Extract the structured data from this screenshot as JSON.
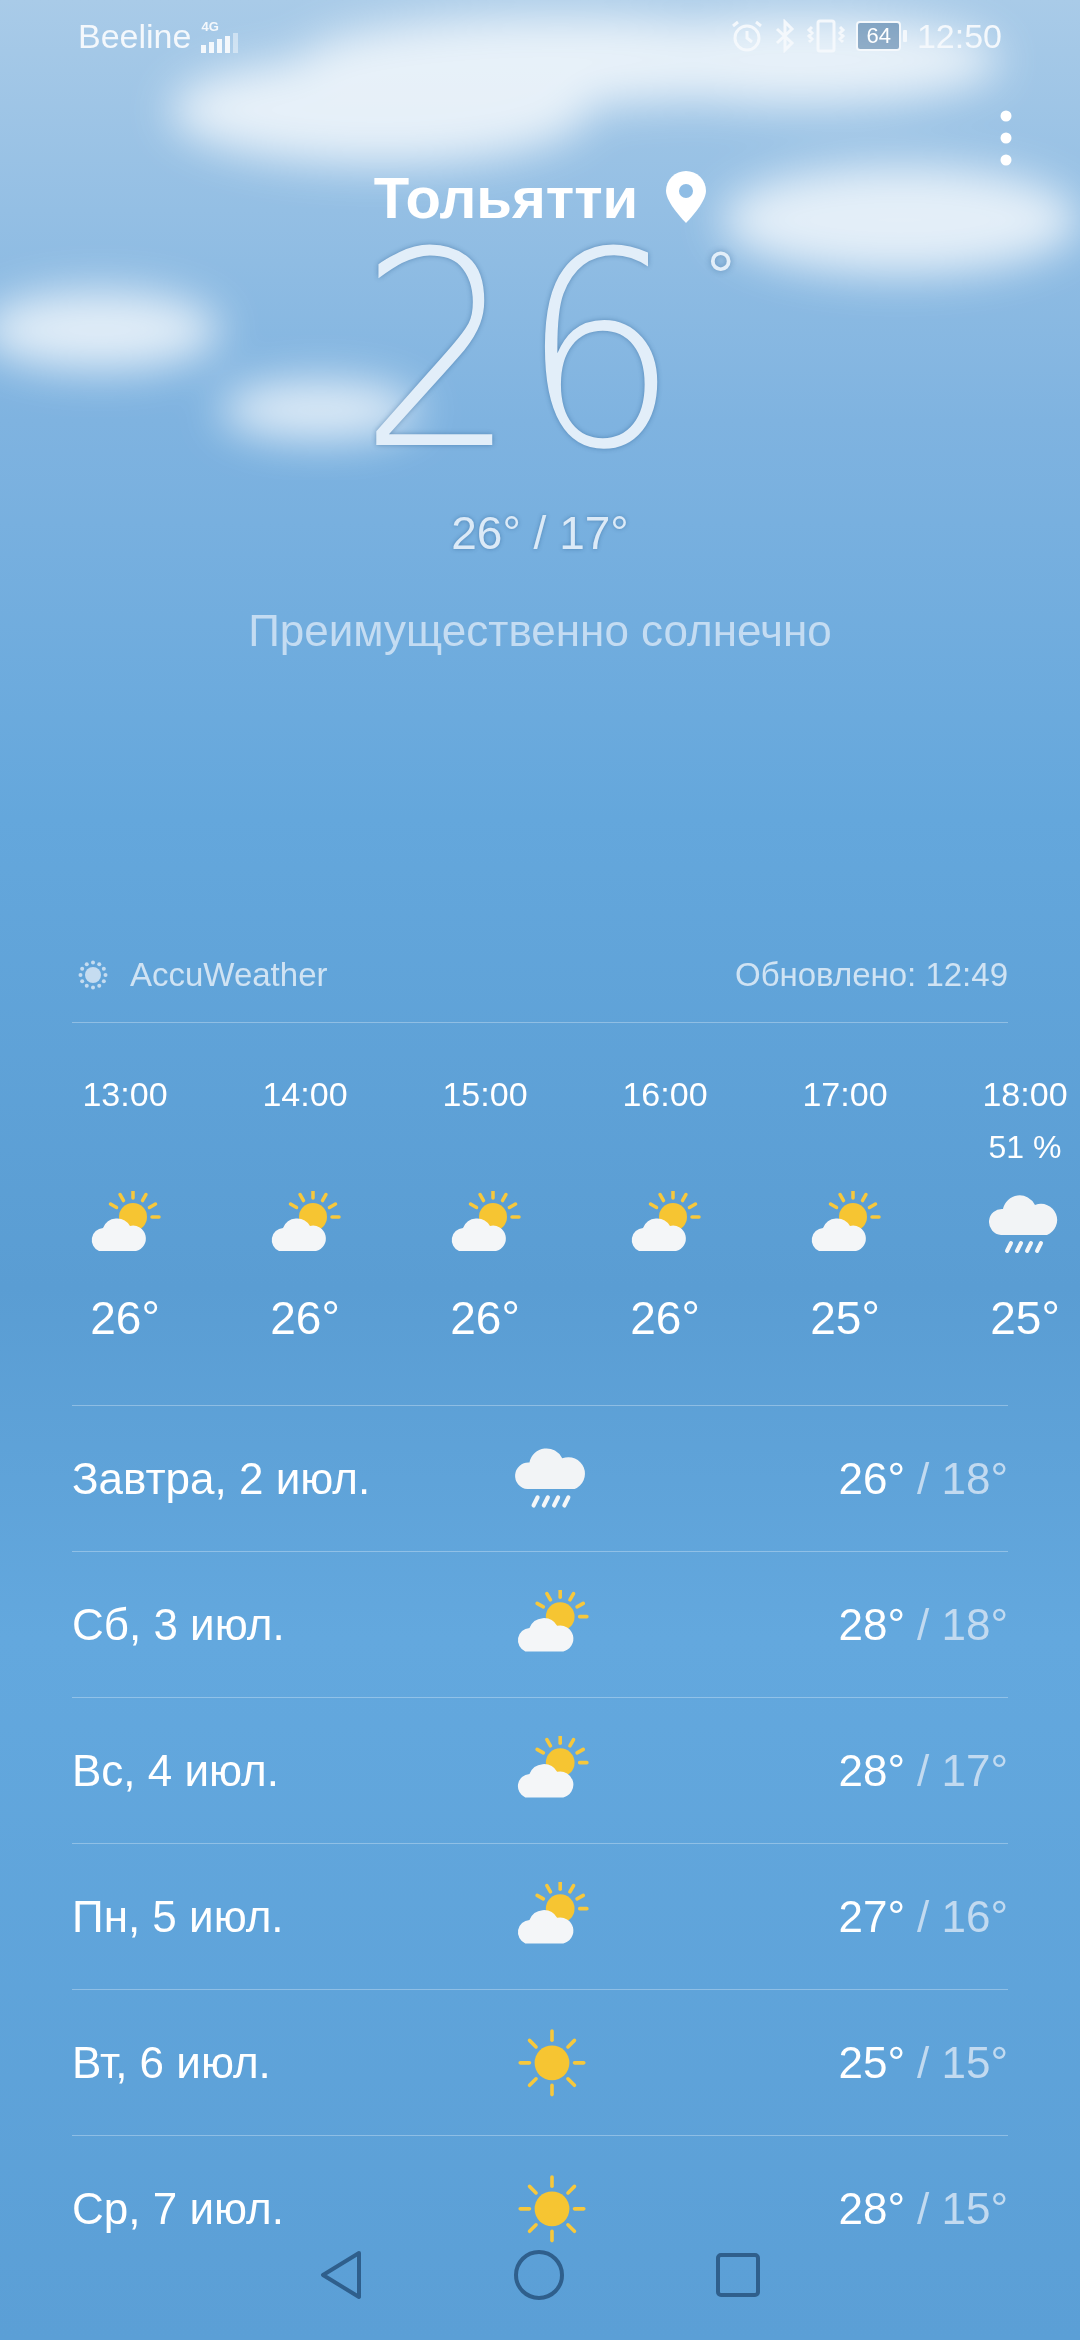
{
  "status_bar": {
    "carrier": "Beeline",
    "network": "4G",
    "battery": "64",
    "time": "12:50"
  },
  "location": {
    "city": "Тольятти",
    "temperature": "26",
    "degree": "°",
    "high_low": "26° / 17°",
    "condition": "Преимущественно солнечно"
  },
  "source": {
    "provider": "AccuWeather",
    "updated": "Обновлено: 12:49"
  },
  "hourly": [
    {
      "time": "13:00",
      "kind": "partly_sunny",
      "temp": "26°"
    },
    {
      "time": "14:00",
      "kind": "partly_sunny",
      "temp": "26°"
    },
    {
      "time": "15:00",
      "kind": "partly_sunny",
      "temp": "26°"
    },
    {
      "time": "16:00",
      "kind": "partly_sunny",
      "temp": "26°"
    },
    {
      "time": "17:00",
      "kind": "partly_sunny",
      "temp": "25°"
    },
    {
      "time": "18:00",
      "precip": "51 %",
      "kind": "rain",
      "temp": "25°"
    }
  ],
  "daily": [
    {
      "day": "Завтра, 2 июл.",
      "kind": "rain",
      "high": "26°",
      "low": "/ 18°"
    },
    {
      "day": "Сб, 3 июл.",
      "kind": "partly_sunny",
      "high": "28°",
      "low": "/ 18°"
    },
    {
      "day": "Вс, 4 июл.",
      "kind": "partly_sunny",
      "high": "28°",
      "low": "/ 17°"
    },
    {
      "day": "Пн, 5 июл.",
      "kind": "partly_sunny",
      "high": "27°",
      "low": "/ 16°"
    },
    {
      "day": "Вт, 6 июл.",
      "kind": "sunny",
      "high": "25°",
      "low": "/ 15°"
    },
    {
      "day": "Ср, 7 июл.",
      "kind": "sunny",
      "high": "28°",
      "low": "/ 15°"
    }
  ]
}
